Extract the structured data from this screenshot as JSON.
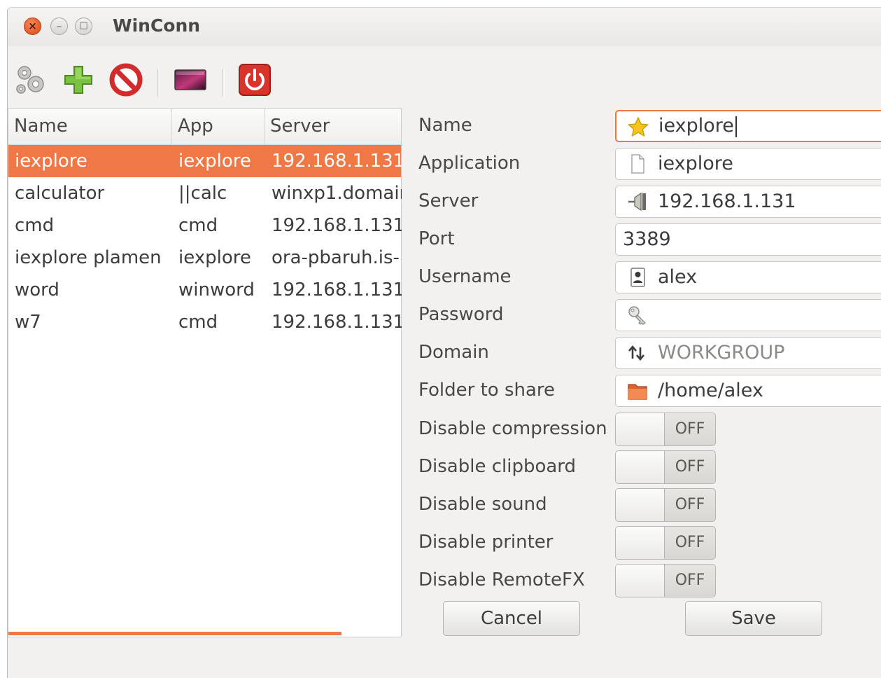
{
  "window": {
    "title": "WinConn"
  },
  "window_buttons": {
    "close": "×",
    "minimize": "–",
    "maximize": "□"
  },
  "toolbar": {
    "items": [
      {
        "name": "settings",
        "icon": "gears-icon"
      },
      {
        "name": "add",
        "icon": "plus-icon"
      },
      {
        "name": "delete",
        "icon": "no-entry-icon"
      },
      {
        "name": "launch",
        "icon": "screen-icon"
      },
      {
        "name": "quit",
        "icon": "power-icon"
      }
    ]
  },
  "list": {
    "columns": [
      "Name",
      "App",
      "Server"
    ],
    "rows": [
      {
        "name": "iexplore",
        "app": "iexplore",
        "server": "192.168.1.131"
      },
      {
        "name": "calculator",
        "app": "||calc",
        "server": "winxp1.domain"
      },
      {
        "name": "cmd",
        "app": "cmd",
        "server": "192.168.1.131"
      },
      {
        "name": "iexplore plamen",
        "app": "iexplore",
        "server": "ora-pbaruh.is-"
      },
      {
        "name": "word",
        "app": "winword",
        "server": "192.168.1.131"
      },
      {
        "name": "w7",
        "app": "cmd",
        "server": "192.168.1.131"
      }
    ],
    "selected_index": 0
  },
  "form": {
    "fields": [
      {
        "label": "Name",
        "value": "iexplore",
        "icon": "star-icon"
      },
      {
        "label": "Application",
        "value": "iexplore",
        "icon": "document-icon"
      },
      {
        "label": "Server",
        "value": "192.168.1.131",
        "icon": "network-plug-icon"
      },
      {
        "label": "Port",
        "value": "3389",
        "icon": ""
      },
      {
        "label": "Username",
        "value": "alex",
        "icon": "user-card-icon"
      },
      {
        "label": "Password",
        "value": "",
        "icon": "key-icon"
      },
      {
        "label": "Domain",
        "placeholder": "WORKGROUP",
        "icon": "arrows-icon"
      },
      {
        "label": "Folder to share",
        "value": "/home/alex",
        "icon": "folder-icon"
      }
    ],
    "toggles": [
      {
        "label": "Disable compression",
        "state": "OFF"
      },
      {
        "label": "Disable clipboard",
        "state": "OFF"
      },
      {
        "label": "Disable sound",
        "state": "OFF"
      },
      {
        "label": "Disable printer",
        "state": "OFF"
      },
      {
        "label": "Disable RemoteFX",
        "state": "OFF"
      }
    ],
    "cancel_label": "Cancel",
    "save_label": "Save"
  },
  "colors": {
    "accent": "#f07746",
    "window_bg": "#f2f1f0",
    "close_button": "#e25a23",
    "power_icon": "#d9342b"
  }
}
